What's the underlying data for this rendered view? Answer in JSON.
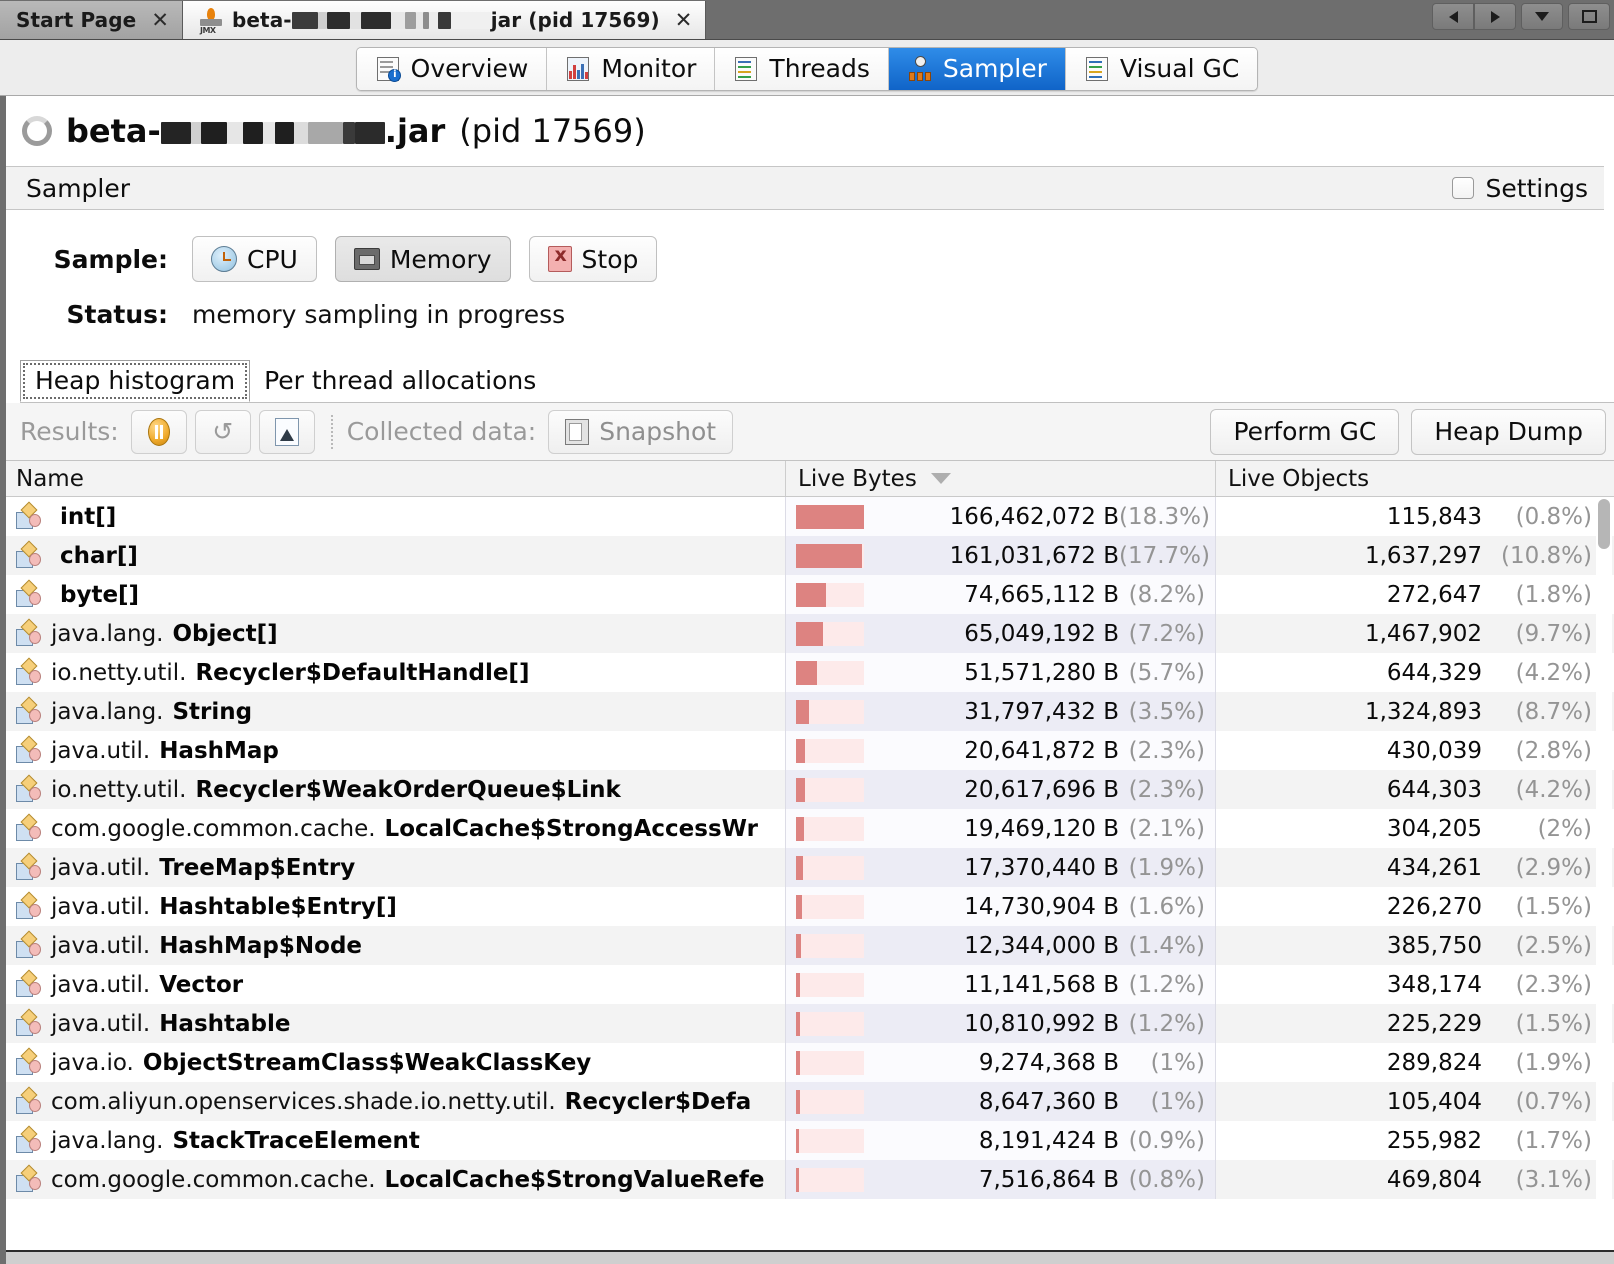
{
  "window": {
    "tabs": [
      {
        "label": "Start Page",
        "icon": "none",
        "active": false,
        "closable": true
      },
      {
        "label_prefix": "beta-",
        "label_suffix": "jar (pid 17569)",
        "redacted": true,
        "icon": "jmx-icon",
        "active": true,
        "closable": true
      }
    ],
    "controls": [
      "scroll-left-button",
      "scroll-right-button",
      "tab-list-dropdown",
      "maximize-button"
    ]
  },
  "viewtabs": [
    {
      "label": "Overview",
      "icon": "overview-icon",
      "selected": false
    },
    {
      "label": "Monitor",
      "icon": "monitor-icon",
      "selected": false
    },
    {
      "label": "Threads",
      "icon": "threads-icon",
      "selected": false
    },
    {
      "label": "Sampler",
      "icon": "sampler-icon",
      "selected": true
    },
    {
      "label": "Visual GC",
      "icon": "visualgc-icon",
      "selected": false
    }
  ],
  "app": {
    "title_prefix": "beta-",
    "title_suffix": ".jar",
    "title_pid": "(pid 17569)",
    "section_title": "Sampler",
    "settings_label": "Settings",
    "settings_checked": false
  },
  "sample": {
    "label": "Sample:",
    "cpu_label": "CPU",
    "memory_label": "Memory",
    "stop_label": "Stop",
    "memory_active": true
  },
  "status": {
    "label": "Status:",
    "value": "memory sampling in progress"
  },
  "subtabs": [
    {
      "label": "Heap histogram",
      "selected": true
    },
    {
      "label": "Per thread allocations",
      "selected": false
    }
  ],
  "resultsbar": {
    "results_label": "Results:",
    "collected_label": "Collected data:",
    "snapshot_label": "Snapshot",
    "perform_gc_label": "Perform GC",
    "heap_dump_label": "Heap Dump",
    "icons": [
      "pause-icon",
      "refresh-icon",
      "delta-icon",
      "snapshot-icon"
    ]
  },
  "table": {
    "columns": [
      "Name",
      "Live Bytes",
      "Live Objects"
    ],
    "sorted_column": "Live Bytes",
    "sort_direction": "descending",
    "accent_bar_color": "#dd8381",
    "accent_bar_bg_color": "#fdeaea",
    "rows": [
      {
        "pkg": "",
        "cls": "int[]",
        "bytes": "166,462,072 B",
        "bytes_pct": "(18.3%)",
        "bytes_pct_num": 18.3,
        "objs": "115,843",
        "objs_pct": "(0.8%)"
      },
      {
        "pkg": "",
        "cls": "char[]",
        "bytes": "161,031,672 B",
        "bytes_pct": "(17.7%)",
        "bytes_pct_num": 17.7,
        "objs": "1,637,297",
        "objs_pct": "(10.8%)"
      },
      {
        "pkg": "",
        "cls": "byte[]",
        "bytes": "74,665,112 B",
        "bytes_pct": "(8.2%)",
        "bytes_pct_num": 8.2,
        "objs": "272,647",
        "objs_pct": "(1.8%)"
      },
      {
        "pkg": "java.lang.",
        "cls": "Object[]",
        "bytes": "65,049,192 B",
        "bytes_pct": "(7.2%)",
        "bytes_pct_num": 7.2,
        "objs": "1,467,902",
        "objs_pct": "(9.7%)"
      },
      {
        "pkg": "io.netty.util.",
        "cls": "Recycler$DefaultHandle[]",
        "bytes": "51,571,280 B",
        "bytes_pct": "(5.7%)",
        "bytes_pct_num": 5.7,
        "objs": "644,329",
        "objs_pct": "(4.2%)"
      },
      {
        "pkg": "java.lang.",
        "cls": "String",
        "bytes": "31,797,432 B",
        "bytes_pct": "(3.5%)",
        "bytes_pct_num": 3.5,
        "objs": "1,324,893",
        "objs_pct": "(8.7%)"
      },
      {
        "pkg": "java.util.",
        "cls": "HashMap",
        "bytes": "20,641,872 B",
        "bytes_pct": "(2.3%)",
        "bytes_pct_num": 2.3,
        "objs": "430,039",
        "objs_pct": "(2.8%)"
      },
      {
        "pkg": "io.netty.util.",
        "cls": "Recycler$WeakOrderQueue$Link",
        "bytes": "20,617,696 B",
        "bytes_pct": "(2.3%)",
        "bytes_pct_num": 2.3,
        "objs": "644,303",
        "objs_pct": "(4.2%)"
      },
      {
        "pkg": "com.google.common.cache.",
        "cls": "LocalCache$StrongAccessWr",
        "bytes": "19,469,120 B",
        "bytes_pct": "(2.1%)",
        "bytes_pct_num": 2.1,
        "objs": "304,205",
        "objs_pct": "(2%)"
      },
      {
        "pkg": "java.util.",
        "cls": "TreeMap$Entry",
        "bytes": "17,370,440 B",
        "bytes_pct": "(1.9%)",
        "bytes_pct_num": 1.9,
        "objs": "434,261",
        "objs_pct": "(2.9%)"
      },
      {
        "pkg": "java.util.",
        "cls": "Hashtable$Entry[]",
        "bytes": "14,730,904 B",
        "bytes_pct": "(1.6%)",
        "bytes_pct_num": 1.6,
        "objs": "226,270",
        "objs_pct": "(1.5%)"
      },
      {
        "pkg": "java.util.",
        "cls": "HashMap$Node",
        "bytes": "12,344,000 B",
        "bytes_pct": "(1.4%)",
        "bytes_pct_num": 1.4,
        "objs": "385,750",
        "objs_pct": "(2.5%)"
      },
      {
        "pkg": "java.util.",
        "cls": "Vector",
        "bytes": "11,141,568 B",
        "bytes_pct": "(1.2%)",
        "bytes_pct_num": 1.2,
        "objs": "348,174",
        "objs_pct": "(2.3%)"
      },
      {
        "pkg": "java.util.",
        "cls": "Hashtable",
        "bytes": "10,810,992 B",
        "bytes_pct": "(1.2%)",
        "bytes_pct_num": 1.2,
        "objs": "225,229",
        "objs_pct": "(1.5%)"
      },
      {
        "pkg": "java.io.",
        "cls": "ObjectStreamClass$WeakClassKey",
        "bytes": "9,274,368 B",
        "bytes_pct": "(1%)",
        "bytes_pct_num": 1.0,
        "objs": "289,824",
        "objs_pct": "(1.9%)"
      },
      {
        "pkg": "com.aliyun.openservices.shade.io.netty.util.",
        "cls": "Recycler$Defa",
        "bytes": "8,647,360 B",
        "bytes_pct": "(1%)",
        "bytes_pct_num": 1.0,
        "objs": "105,404",
        "objs_pct": "(0.7%)"
      },
      {
        "pkg": "java.lang.",
        "cls": "StackTraceElement",
        "bytes": "8,191,424 B",
        "bytes_pct": "(0.9%)",
        "bytes_pct_num": 0.9,
        "objs": "255,982",
        "objs_pct": "(1.7%)"
      },
      {
        "pkg": "com.google.common.cache.",
        "cls": "LocalCache$StrongValueRefe",
        "bytes": "7,516,864 B",
        "bytes_pct": "(0.8%)",
        "bytes_pct_num": 0.8,
        "objs": "469,804",
        "objs_pct": "(3.1%)"
      }
    ]
  }
}
